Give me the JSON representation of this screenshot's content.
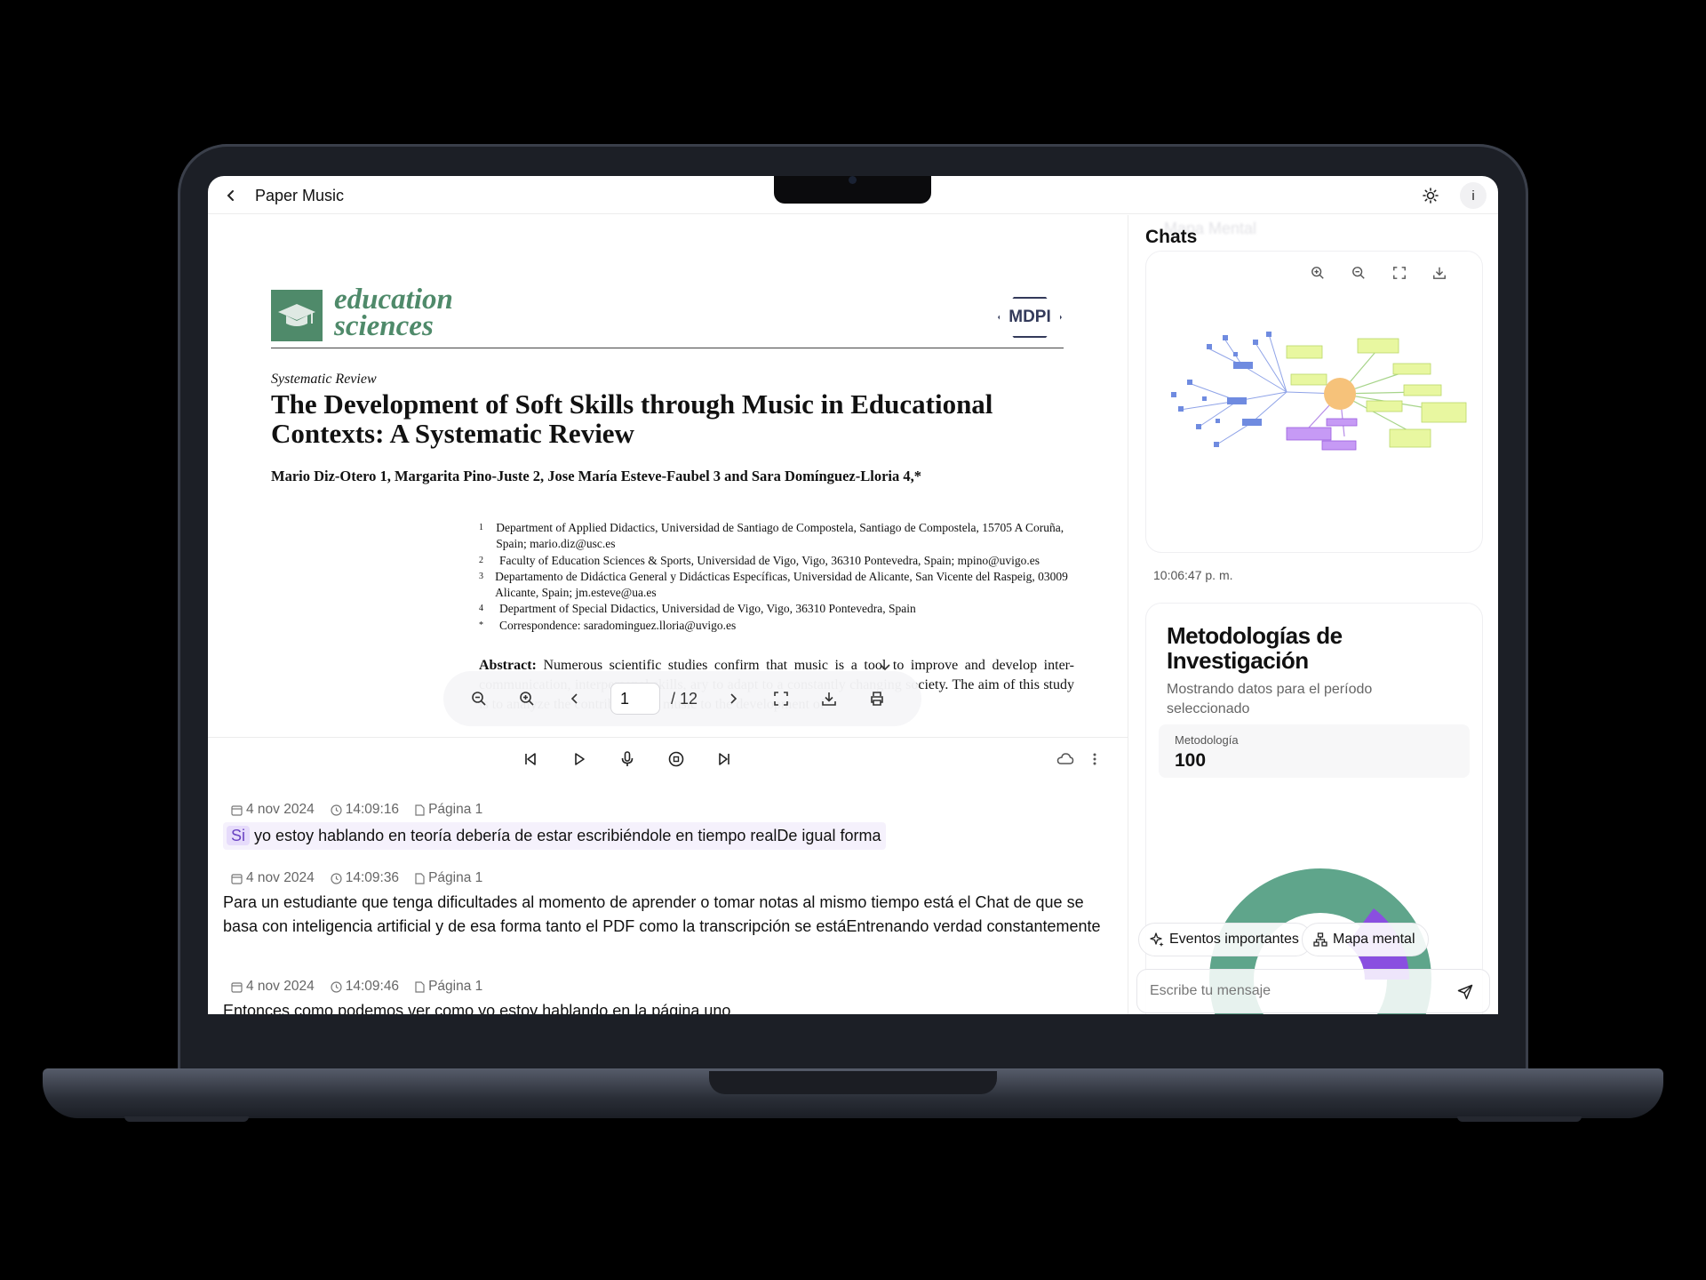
{
  "app": {
    "title": "Paper Music",
    "info_label": "i"
  },
  "pdf": {
    "journal_name_line1": "education",
    "journal_name_line2": "sciences",
    "publisher_logo": "MDPI",
    "article_type": "Systematic Review",
    "title": "The Development of Soft Skills through Music in Educational Contexts: A Systematic Review",
    "authors": "Mario Diz-Otero 1, Margarita Pino-Juste 2, Jose María Esteve-Faubel 3 and Sara Domínguez-Lloria 4,*",
    "affiliations": [
      {
        "num": "1",
        "text": "Department of Applied Didactics, Universidad de Santiago de Compostela, Santiago de Compostela, 15705 A Coruña, Spain; mario.diz@usc.es"
      },
      {
        "num": "2",
        "text": "Faculty of Education Sciences & Sports, Universidad de Vigo, Vigo, 36310 Pontevedra, Spain; mpino@uvigo.es"
      },
      {
        "num": "3",
        "text": "Departamento de Didáctica General y Didácticas Específicas, Universidad de Alicante, San Vicente del Raspeig, 03009 Alicante, Spain; jm.esteve@ua.es"
      },
      {
        "num": "4",
        "text": "Department of Special Didactics, Universidad de Vigo, Vigo, 36310 Pontevedra, Spain"
      },
      {
        "num": "*",
        "text": "Correspondence: saradominguez.lloria@uvigo.es"
      }
    ],
    "abstract_label": "Abstract:",
    "abstract_text": "Numerous scientific studies confirm that music is a tool to improve and develop inter- communication, interpersonal skills, ary to adapt to a constantly changing society. The aim of this study is to analyze the contribution of music to the development of"
  },
  "pdf_toolbar": {
    "current_page": "1",
    "total_pages": "/ 12"
  },
  "transcript": [
    {
      "date": "4 nov 2024",
      "time": "14:09:16",
      "page": "Página 1",
      "highlight": "Si",
      "text": "yo estoy hablando en teoría debería de estar escribiéndole en tiempo realDe igual forma"
    },
    {
      "date": "4 nov 2024",
      "time": "14:09:36",
      "page": "Página 1",
      "text": "Para un estudiante que tenga dificultades al momento de aprender o tomar notas al mismo tiempo está el Chat de que se basa con inteligencia artificial y de esa forma tanto el PDF como la transcripción se estáEntrenando verdad constantemente"
    },
    {
      "date": "4 nov 2024",
      "time": "14:09:46",
      "page": "Página 1",
      "text": "Entonces como podemos ver como yo estoy hablando en la página uno"
    }
  ],
  "right_panel": {
    "title": "Chats",
    "ghost_title": "Mapa Mental",
    "map_timestamp": "10:06:47 p. m.",
    "metrics": {
      "title": "Metodologías de Investigación",
      "subtitle": "Mostrando datos para el período seleccionado",
      "metric_label": "Metodología",
      "metric_value": "100",
      "donut_colors": [
        "#5fa58b",
        "#8a4fe0"
      ]
    },
    "pills": {
      "events": "Eventos importantes",
      "mindmap": "Mapa mental"
    },
    "message_placeholder": "Escribe tu mensaje"
  }
}
